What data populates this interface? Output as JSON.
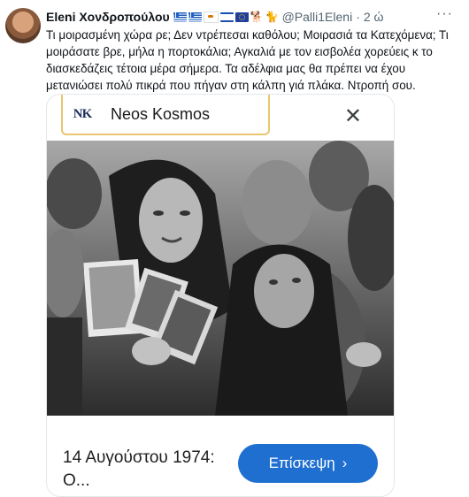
{
  "tweet": {
    "author_name": "Eleni Χονδροπούλου",
    "handle": "@Palli1Eleni",
    "separator": "·",
    "time": "2 ώ",
    "more_icon": "more-icon",
    "text": "Τι μοιρασμένη χώρα ρε; Δεν ντρέπεσαι καθόλου; Μοιρασιά τα Κατεχόμενα; Τι μοιράσατε βρε, μήλα η  πορτοκάλια; Αγκαλιά με τον εισβολέα χορεύεις κ το διασκεδάζεις τέτοια μέρα σήμερα. Τα αδέλφια μας θα πρέπει να έχου μετανιώσει πολύ πικρά που πήγαν στη κάλπη γιά πλάκα. Ντροπή σου.",
    "name_flags": [
      "greek-flag",
      "greek-flag",
      "cyprus-flag",
      "israel-flag",
      "eu-flag"
    ],
    "name_emojis": [
      "🐕",
      "🐈"
    ]
  },
  "card": {
    "source_logo": "NK",
    "source_name": "Neos Kosmos",
    "close_icon": "close-icon",
    "image_alt": "black-and-white photo of grieving women holding photographs",
    "lens_icon": "google-lens-icon",
    "title": "14 Αυγούστου 1974: Ο...",
    "visit_label": "Επίσκεψη",
    "visit_chevron": "›",
    "colors": {
      "button": "#1f6fd1",
      "border_accent": "#e8c670"
    }
  }
}
